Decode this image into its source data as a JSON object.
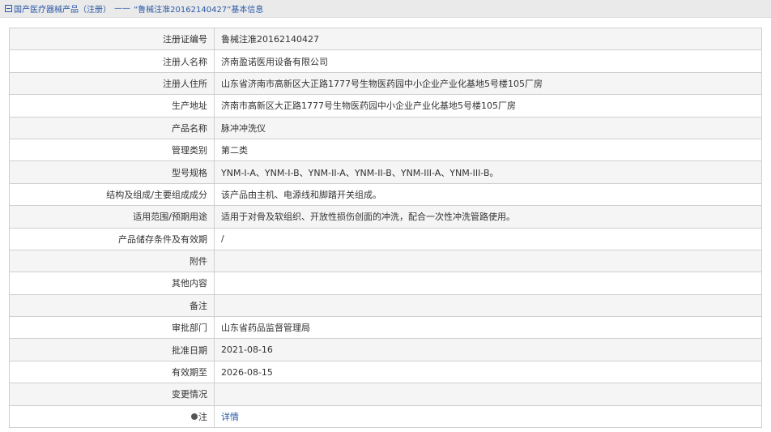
{
  "breadcrumb": {
    "icon": "document-icon",
    "category": "国产医疗器械产品（注册）",
    "separator": "——",
    "current": "“鲁械注准20162140427”基本信息"
  },
  "rows": [
    {
      "label": "注册证编号",
      "value": "鲁械注准20162140427"
    },
    {
      "label": "注册人名称",
      "value": "济南盈诺医用设备有限公司"
    },
    {
      "label": "注册人住所",
      "value": "山东省济南市高新区大正路1777号生物医药园中小企业产业化基地5号楼105厂房"
    },
    {
      "label": "生产地址",
      "value": "济南市高新区大正路1777号生物医药园中小企业产业化基地5号楼105厂房"
    },
    {
      "label": "产品名称",
      "value": "脉冲冲洗仪"
    },
    {
      "label": "管理类别",
      "value": "第二类"
    },
    {
      "label": "型号规格",
      "value": "YNM-I-A、YNM-I-B、YNM-II-A、YNM-II-B、YNM-III-A、YNM-III-B。"
    },
    {
      "label": "结构及组成/主要组成成分",
      "value": "该产品由主机、电源线和脚踏开关组成。"
    },
    {
      "label": "适用范围/预期用途",
      "value": "适用于对骨及软组织、开放性损伤创面的冲洗，配合一次性冲洗管路使用。"
    },
    {
      "label": "产品储存条件及有效期",
      "value": "/"
    },
    {
      "label": "附件",
      "value": ""
    },
    {
      "label": "其他内容",
      "value": ""
    },
    {
      "label": "备注",
      "value": ""
    },
    {
      "label": "审批部门",
      "value": "山东省药品监督管理局"
    },
    {
      "label": "批准日期",
      "value": "2021-08-16"
    },
    {
      "label": "有效期至",
      "value": "2026-08-15"
    },
    {
      "label": "变更情况",
      "value": ""
    }
  ],
  "note_row": {
    "label": "注",
    "link": "详情",
    "icon": "info-bullet-icon"
  }
}
